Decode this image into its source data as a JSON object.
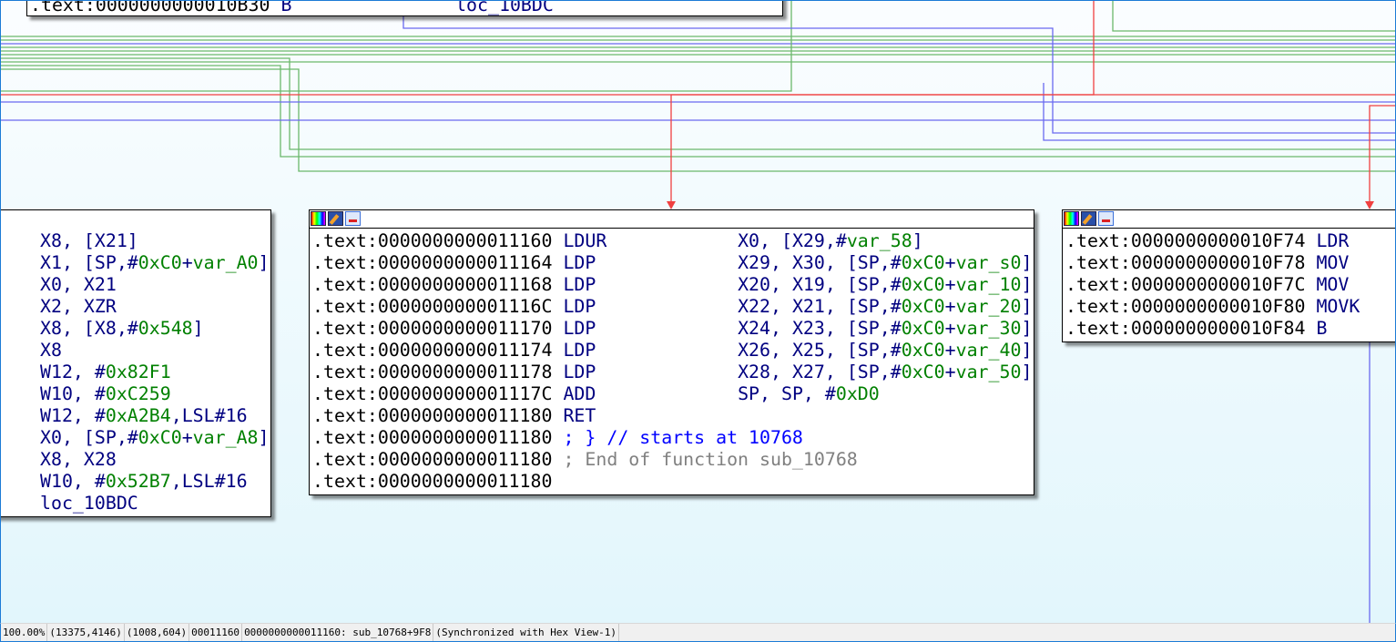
{
  "colors": {
    "edge_green": "#6bb86b",
    "edge_blue": "#6a6af0",
    "edge_red": "#f04040",
    "mnemonic": "#000080",
    "number": "#008000",
    "comment": "#0000ff",
    "end_comment": "#808080"
  },
  "node_icons": [
    "color-palette-icon",
    "edit-node-icon",
    "graph-node-icon"
  ],
  "top_node": {
    "lines": [
      {
        "addr": ".text:0000000000010B30",
        "mn": "B",
        "op": "loc_10BDC"
      }
    ]
  },
  "left_node": {
    "lines": [
      {
        "op": "X8, [X21]"
      },
      {
        "op": "X1, [SP,#0xC0+var_A0]"
      },
      {
        "op": "X0, X21"
      },
      {
        "op": "X2, XZR"
      },
      {
        "op": "X8, [X8,#0x548]"
      },
      {
        "op": "X8"
      },
      {
        "op": "W12, #0x82F1"
      },
      {
        "op": "W10, #0xC259"
      },
      {
        "op": "W12, #0xA2B4,LSL#16"
      },
      {
        "op": "X0, [SP,#0xC0+var_A8]"
      },
      {
        "op": "X8, X28"
      },
      {
        "op": "W10, #0x52B7,LSL#16"
      },
      {
        "op": "loc_10BDC"
      }
    ]
  },
  "middle_node": {
    "lines": [
      {
        "addr": ".text:0000000000011160",
        "mn": "LDUR",
        "op": "X0, [X29,#var_58]"
      },
      {
        "addr": ".text:0000000000011164",
        "mn": "LDP",
        "op": "X29, X30, [SP,#0xC0+var_s0]"
      },
      {
        "addr": ".text:0000000000011168",
        "mn": "LDP",
        "op": "X20, X19, [SP,#0xC0+var_10]"
      },
      {
        "addr": ".text:000000000001116C",
        "mn": "LDP",
        "op": "X22, X21, [SP,#0xC0+var_20]"
      },
      {
        "addr": ".text:0000000000011170",
        "mn": "LDP",
        "op": "X24, X23, [SP,#0xC0+var_30]"
      },
      {
        "addr": ".text:0000000000011174",
        "mn": "LDP",
        "op": "X26, X25, [SP,#0xC0+var_40]"
      },
      {
        "addr": ".text:0000000000011178",
        "mn": "LDP",
        "op": "X28, X27, [SP,#0xC0+var_50]"
      },
      {
        "addr": ".text:000000000001117C",
        "mn": "ADD",
        "op": "SP, SP, #0xD0"
      },
      {
        "addr": ".text:0000000000011180",
        "mn": "RET",
        "op": ""
      },
      {
        "addr": ".text:0000000000011180",
        "comment": "; } // starts at 10768",
        "ctype": "cmt"
      },
      {
        "addr": ".text:0000000000011180",
        "comment": "; End of function sub_10768",
        "ctype": "gry"
      },
      {
        "addr": ".text:0000000000011180"
      }
    ]
  },
  "right_node": {
    "lines": [
      {
        "addr": ".text:0000000000010F74",
        "mn": "LDR"
      },
      {
        "addr": ".text:0000000000010F78",
        "mn": "MOV"
      },
      {
        "addr": ".text:0000000000010F7C",
        "mn": "MOV"
      },
      {
        "addr": ".text:0000000000010F80",
        "mn": "MOVK"
      },
      {
        "addr": ".text:0000000000010F84",
        "mn": "B"
      }
    ]
  },
  "status": {
    "zoom": "100.00%",
    "graph_coords": "(13375,4146)",
    "mouse_coords": "(1008,604)",
    "offset": "00011160",
    "location": "0000000000011160: sub_10768+9F8",
    "sync": "(Synchronized with Hex View-1)"
  }
}
